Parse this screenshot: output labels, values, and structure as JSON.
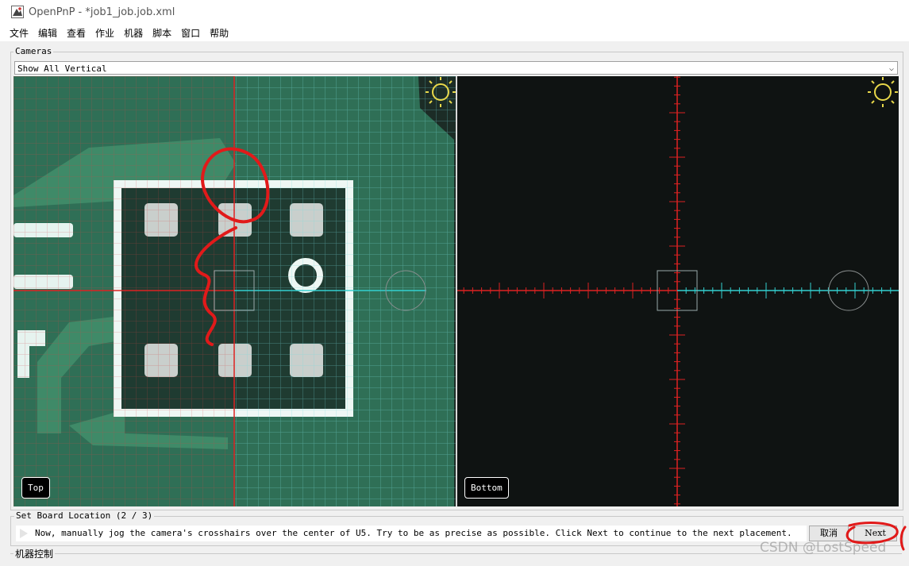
{
  "window": {
    "title": "OpenPnP - *job1_job.job.xml"
  },
  "menu": [
    "文件",
    "编辑",
    "查看",
    "作业",
    "机器",
    "脚本",
    "窗口",
    "帮助"
  ],
  "cameras_panel": {
    "legend": "Cameras",
    "selector_value": "Show All Vertical",
    "views": [
      {
        "label": "Top"
      },
      {
        "label": "Bottom"
      }
    ]
  },
  "board_location": {
    "legend": "Set Board Location (2 / 3)",
    "instruction": "Now, manually jog the camera's crosshairs over the center of U5. Try to be as precise as possible. Click Next to continue to the next placement.",
    "cancel_label": "取消",
    "next_label": "Next"
  },
  "machine_panel": {
    "legend": "机器控制"
  },
  "watermark": "CSDN @LostSpeed",
  "colors": {
    "crosshair_red": "#dd2222",
    "crosshair_cyan": "#33d0d0",
    "annotation_red": "#e11a1a"
  }
}
